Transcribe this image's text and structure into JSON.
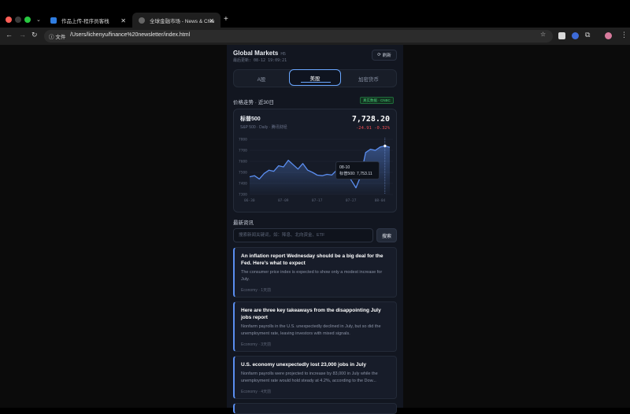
{
  "browser": {
    "tabs": [
      {
        "title": "作品上传-程序员客栈",
        "active": false
      },
      {
        "title": "全球金融市场 - News & Charts",
        "active": true
      }
    ],
    "url_scheme_label": "文件",
    "url": "/Users/lichenyu/finance%20newsletter/index.html"
  },
  "header": {
    "title": "Global Markets",
    "tag": "H5",
    "updated": "最后更新: 08-12 19:09:21",
    "refresh_label": "刷新"
  },
  "market_tabs": [
    {
      "label": "A股",
      "active": false
    },
    {
      "label": "美股",
      "active": true
    },
    {
      "label": "加密货币",
      "active": false
    }
  ],
  "price_section": {
    "title": "价格走势 · 近30日",
    "source_badge": "真实数据 · CNBC"
  },
  "quote": {
    "name": "标普500",
    "subtitle": "S&P 500 · Daily · 腾讯财经",
    "price": "7,728.20",
    "change": "-24.91  -0.32%",
    "change_color": "#f04e54"
  },
  "tooltip": {
    "date": "08-10",
    "text": "标普500: 7,753.11"
  },
  "chart_data": {
    "type": "area",
    "y_ticks": [
      "7800",
      "7700",
      "7600",
      "7500",
      "7400",
      "7300"
    ],
    "ylim": [
      7300,
      7800
    ],
    "x_ticks": [
      "06-30",
      "07-09",
      "07-17",
      "07-27",
      "08-04"
    ],
    "series": [
      {
        "values": [
          7460,
          7470,
          7440,
          7490,
          7520,
          7510,
          7560,
          7550,
          7610,
          7570,
          7530,
          7580,
          7520,
          7500,
          7475,
          7470,
          7482,
          7476,
          7520,
          7540,
          7510,
          7430,
          7360,
          7470,
          7680,
          7710,
          7700,
          7730,
          7740,
          7728
        ],
        "color": "#5b8ef0"
      }
    ]
  },
  "news_section": {
    "title": "最新资讯",
    "search_placeholder": "搜索新闻关键词，如：降息、北向资金、ETF",
    "search_button": "搜索"
  },
  "news": [
    {
      "headline": "An inflation report Wednesday should be a big deal for the Fed. Here's what to expect",
      "summary": "The consumer price index is expected to show only a modest increase for July.",
      "meta": "Economy · 1天前"
    },
    {
      "headline": "Here are three key takeaways from the disappointing July jobs report",
      "summary": "Nonfarm payrolls in the U.S. unexpectedly declined in July, but so did the unemployment rate, leaving investors with mixed signals.",
      "meta": "Economy · 3天前"
    },
    {
      "headline": "U.S. economy unexpectedly lost 23,000 jobs in July",
      "summary": "Nonfarm payrolls were projected to increase by 83,000 in July while the unemployment rate would hold steady at 4.2%, according to the Dow...",
      "meta": "Economy · 4天前"
    }
  ]
}
